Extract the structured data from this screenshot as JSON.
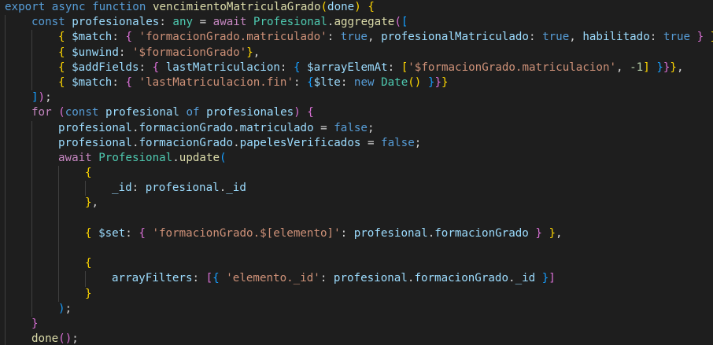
{
  "editor": {
    "language": "javascript",
    "theme_colors": {
      "background": "#1e1e1e",
      "keyword": "#569cd6",
      "control": "#c586c0",
      "function": "#dcdcaa",
      "variable": "#9cdcfe",
      "type": "#4ec9b0",
      "string": "#ce9178",
      "number": "#b5cea8",
      "bracket_1": "#ffd700",
      "bracket_2": "#da70d6",
      "bracket_3": "#179fff"
    },
    "lines": [
      {
        "indent": 0,
        "tokens": [
          [
            "kw",
            "export"
          ],
          [
            "op",
            " "
          ],
          [
            "kw",
            "async"
          ],
          [
            "op",
            " "
          ],
          [
            "kw",
            "function"
          ],
          [
            "op",
            " "
          ],
          [
            "fn",
            "vencimientoMatriculaGrado"
          ],
          [
            "b1",
            "("
          ],
          [
            "var",
            "done"
          ],
          [
            "b1",
            ")"
          ],
          [
            "op",
            " "
          ],
          [
            "b1",
            "{"
          ]
        ]
      },
      {
        "indent": 1,
        "tokens": [
          [
            "kw",
            "const"
          ],
          [
            "op",
            " "
          ],
          [
            "var",
            "profesionales"
          ],
          [
            "op",
            ": "
          ],
          [
            "type",
            "any"
          ],
          [
            "op",
            " = "
          ],
          [
            "ctl",
            "await"
          ],
          [
            "op",
            " "
          ],
          [
            "type",
            "Profesional"
          ],
          [
            "op",
            "."
          ],
          [
            "fn",
            "aggregate"
          ],
          [
            "b2",
            "("
          ],
          [
            "b3",
            "["
          ]
        ]
      },
      {
        "indent": 2,
        "tokens": [
          [
            "b1",
            "{"
          ],
          [
            "op",
            " "
          ],
          [
            "var",
            "$match"
          ],
          [
            "op",
            ": "
          ],
          [
            "b2",
            "{"
          ],
          [
            "op",
            " "
          ],
          [
            "str",
            "'formacionGrado.matriculado'"
          ],
          [
            "op",
            ": "
          ],
          [
            "kw",
            "true"
          ],
          [
            "op",
            ", "
          ],
          [
            "var",
            "profesionalMatriculado"
          ],
          [
            "op",
            ": "
          ],
          [
            "kw",
            "true"
          ],
          [
            "op",
            ", "
          ],
          [
            "var",
            "habilitado"
          ],
          [
            "op",
            ": "
          ],
          [
            "kw",
            "true"
          ],
          [
            "op",
            " "
          ],
          [
            "b2",
            "}"
          ],
          [
            "op",
            " "
          ],
          [
            "b1",
            "}"
          ],
          [
            "op",
            ","
          ]
        ]
      },
      {
        "indent": 2,
        "tokens": [
          [
            "b1",
            "{"
          ],
          [
            "op",
            " "
          ],
          [
            "var",
            "$unwind"
          ],
          [
            "op",
            ": "
          ],
          [
            "str",
            "'$formacionGrado'"
          ],
          [
            "b1",
            "}"
          ],
          [
            "op",
            ","
          ]
        ]
      },
      {
        "indent": 2,
        "tokens": [
          [
            "b1",
            "{"
          ],
          [
            "op",
            " "
          ],
          [
            "var",
            "$addFields"
          ],
          [
            "op",
            ": "
          ],
          [
            "b2",
            "{"
          ],
          [
            "op",
            " "
          ],
          [
            "var",
            "lastMatriculacion"
          ],
          [
            "op",
            ": "
          ],
          [
            "b3",
            "{"
          ],
          [
            "op",
            " "
          ],
          [
            "var",
            "$arrayElemAt"
          ],
          [
            "op",
            ": "
          ],
          [
            "b1",
            "["
          ],
          [
            "str",
            "'$formacionGrado.matriculacion'"
          ],
          [
            "op",
            ", "
          ],
          [
            "num",
            "-1"
          ],
          [
            "b1",
            "]"
          ],
          [
            "op",
            " "
          ],
          [
            "b3",
            "}"
          ],
          [
            "b2",
            "}"
          ],
          [
            "b1",
            "}"
          ],
          [
            "op",
            ","
          ]
        ]
      },
      {
        "indent": 2,
        "tokens": [
          [
            "b1",
            "{"
          ],
          [
            "op",
            " "
          ],
          [
            "var",
            "$match"
          ],
          [
            "op",
            ": "
          ],
          [
            "b2",
            "{"
          ],
          [
            "op",
            " "
          ],
          [
            "str",
            "'lastMatriculacion.fin'"
          ],
          [
            "op",
            ": "
          ],
          [
            "b3",
            "{"
          ],
          [
            "var",
            "$lte"
          ],
          [
            "op",
            ": "
          ],
          [
            "kw",
            "new"
          ],
          [
            "op",
            " "
          ],
          [
            "type",
            "Date"
          ],
          [
            "b1",
            "()"
          ],
          [
            "op",
            " "
          ],
          [
            "b3",
            "}"
          ],
          [
            "b2",
            "}"
          ],
          [
            "b1",
            "}"
          ]
        ]
      },
      {
        "indent": 1,
        "tokens": [
          [
            "b3",
            "]"
          ],
          [
            "b2",
            ")"
          ],
          [
            "op",
            ";"
          ]
        ]
      },
      {
        "indent": 1,
        "tokens": [
          [
            "ctl",
            "for"
          ],
          [
            "op",
            " "
          ],
          [
            "b2",
            "("
          ],
          [
            "kw",
            "const"
          ],
          [
            "op",
            " "
          ],
          [
            "var",
            "profesional"
          ],
          [
            "op",
            " "
          ],
          [
            "kw",
            "of"
          ],
          [
            "op",
            " "
          ],
          [
            "var",
            "profesionales"
          ],
          [
            "b2",
            ")"
          ],
          [
            "op",
            " "
          ],
          [
            "b2",
            "{"
          ]
        ]
      },
      {
        "indent": 2,
        "tokens": [
          [
            "var",
            "profesional"
          ],
          [
            "op",
            "."
          ],
          [
            "var",
            "formacionGrado"
          ],
          [
            "op",
            "."
          ],
          [
            "var",
            "matriculado"
          ],
          [
            "op",
            " = "
          ],
          [
            "kw",
            "false"
          ],
          [
            "op",
            ";"
          ]
        ]
      },
      {
        "indent": 2,
        "tokens": [
          [
            "var",
            "profesional"
          ],
          [
            "op",
            "."
          ],
          [
            "var",
            "formacionGrado"
          ],
          [
            "op",
            "."
          ],
          [
            "var",
            "papelesVerificados"
          ],
          [
            "op",
            " = "
          ],
          [
            "kw",
            "false"
          ],
          [
            "op",
            ";"
          ]
        ]
      },
      {
        "indent": 2,
        "tokens": [
          [
            "ctl",
            "await"
          ],
          [
            "op",
            " "
          ],
          [
            "type",
            "Profesional"
          ],
          [
            "op",
            "."
          ],
          [
            "fn",
            "update"
          ],
          [
            "b3",
            "("
          ]
        ]
      },
      {
        "indent": 3,
        "tokens": [
          [
            "b1",
            "{"
          ]
        ]
      },
      {
        "indent": 4,
        "tokens": [
          [
            "var",
            "_id"
          ],
          [
            "op",
            ": "
          ],
          [
            "var",
            "profesional"
          ],
          [
            "op",
            "."
          ],
          [
            "var",
            "_id"
          ]
        ]
      },
      {
        "indent": 3,
        "tokens": [
          [
            "b1",
            "}"
          ],
          [
            "op",
            ","
          ]
        ]
      },
      {
        "indent": 0,
        "tokens": []
      },
      {
        "indent": 3,
        "tokens": [
          [
            "b1",
            "{"
          ],
          [
            "op",
            " "
          ],
          [
            "var",
            "$set"
          ],
          [
            "op",
            ": "
          ],
          [
            "b2",
            "{"
          ],
          [
            "op",
            " "
          ],
          [
            "str",
            "'formacionGrado.$[elemento]'"
          ],
          [
            "op",
            ": "
          ],
          [
            "var",
            "profesional"
          ],
          [
            "op",
            "."
          ],
          [
            "var",
            "formacionGrado"
          ],
          [
            "op",
            " "
          ],
          [
            "b2",
            "}"
          ],
          [
            "op",
            " "
          ],
          [
            "b1",
            "}"
          ],
          [
            "op",
            ","
          ]
        ]
      },
      {
        "indent": 0,
        "tokens": []
      },
      {
        "indent": 3,
        "tokens": [
          [
            "b1",
            "{"
          ]
        ]
      },
      {
        "indent": 4,
        "tokens": [
          [
            "var",
            "arrayFilters"
          ],
          [
            "op",
            ": "
          ],
          [
            "b2",
            "["
          ],
          [
            "b3",
            "{"
          ],
          [
            "op",
            " "
          ],
          [
            "str",
            "'elemento._id'"
          ],
          [
            "op",
            ": "
          ],
          [
            "var",
            "profesional"
          ],
          [
            "op",
            "."
          ],
          [
            "var",
            "formacionGrado"
          ],
          [
            "op",
            "."
          ],
          [
            "var",
            "_id"
          ],
          [
            "op",
            " "
          ],
          [
            "b3",
            "}"
          ],
          [
            "b2",
            "]"
          ]
        ]
      },
      {
        "indent": 3,
        "tokens": [
          [
            "b1",
            "}"
          ]
        ]
      },
      {
        "indent": 2,
        "tokens": [
          [
            "b3",
            ")"
          ],
          [
            "op",
            ";"
          ]
        ]
      },
      {
        "indent": 1,
        "tokens": [
          [
            "b2",
            "}"
          ]
        ]
      },
      {
        "indent": 1,
        "tokens": [
          [
            "fn",
            "done"
          ],
          [
            "b2",
            "()"
          ],
          [
            "op",
            ";"
          ]
        ]
      }
    ]
  }
}
